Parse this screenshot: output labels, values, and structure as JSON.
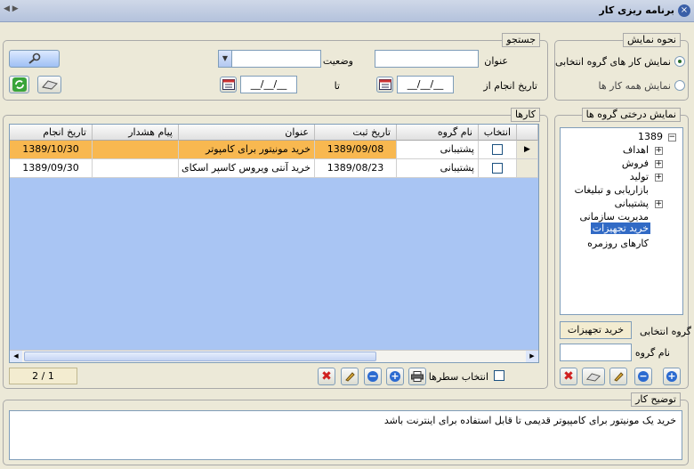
{
  "window": {
    "title": "برنامه ریزی کار",
    "close_icon": "close-icon",
    "nav_arrows": "◀ ▶"
  },
  "display_mode": {
    "legend": "نحوه نمایش",
    "options": [
      {
        "label": "نمایش کار های گروه انتخابی",
        "selected": true
      },
      {
        "label": "نمایش همه کار ها",
        "selected": false
      }
    ]
  },
  "search": {
    "legend": "جستجو",
    "title_label": "عنوان",
    "title_value": "",
    "status_label": "وضعیت",
    "status_value": "",
    "date_from_label": "تاریخ انجام از",
    "date_from_value": "__/__/__",
    "date_to_label": "تا",
    "date_to_value": "__/__/__"
  },
  "tree": {
    "legend": "نمایش درختی گروه ها",
    "root": "1389",
    "items": [
      {
        "label": "اهداف",
        "expandable": true
      },
      {
        "label": "فروش",
        "expandable": true
      },
      {
        "label": "تولید",
        "expandable": true
      },
      {
        "label": "بازاریابی و تبلیغات",
        "expandable": false
      },
      {
        "label": "پشتیبانی",
        "expandable": true
      },
      {
        "label": "مدیریت سازمانی",
        "expandable": false
      },
      {
        "label": "خرید تجهیزات",
        "expandable": false,
        "selected": true
      },
      {
        "label": "کارهای روزمره",
        "expandable": false
      }
    ],
    "selected_group_label": "گروه انتخابی",
    "selected_group_value": "خرید تجهیزات",
    "group_name_label": "نام گروه",
    "group_name_value": ""
  },
  "tasks": {
    "legend": "کارها",
    "columns": [
      "انتخاب",
      "نام گروه",
      "تاریخ ثبت",
      "عنوان",
      "پیام هشدار",
      "تاریخ انجام"
    ],
    "rows": [
      {
        "checked": false,
        "group": "پشتیبانی",
        "reg_date": "1389/09/08",
        "title": "خرید مونیتور برای کامپوتر",
        "alert": "",
        "due_date": "1389/10/30",
        "selected": true
      },
      {
        "checked": false,
        "group": "پشتیبانی",
        "reg_date": "1389/08/23",
        "title": "خرید آنتی ویروس کاسپر اسکای",
        "alert": "",
        "due_date": "1389/09/30",
        "selected": false
      }
    ],
    "select_rows_label": "انتخاب سطرها",
    "pager": "2 / 1"
  },
  "description": {
    "legend": "توضیح کار",
    "text": "خرید یک مونیتور برای کامپیوتر قدیمی تا قابل استفاده برای اینترنت باشد"
  },
  "colors": {
    "accent": "#2b6ad0",
    "grid_bg": "#a9c5f3",
    "selected_row": "#f5b040"
  }
}
